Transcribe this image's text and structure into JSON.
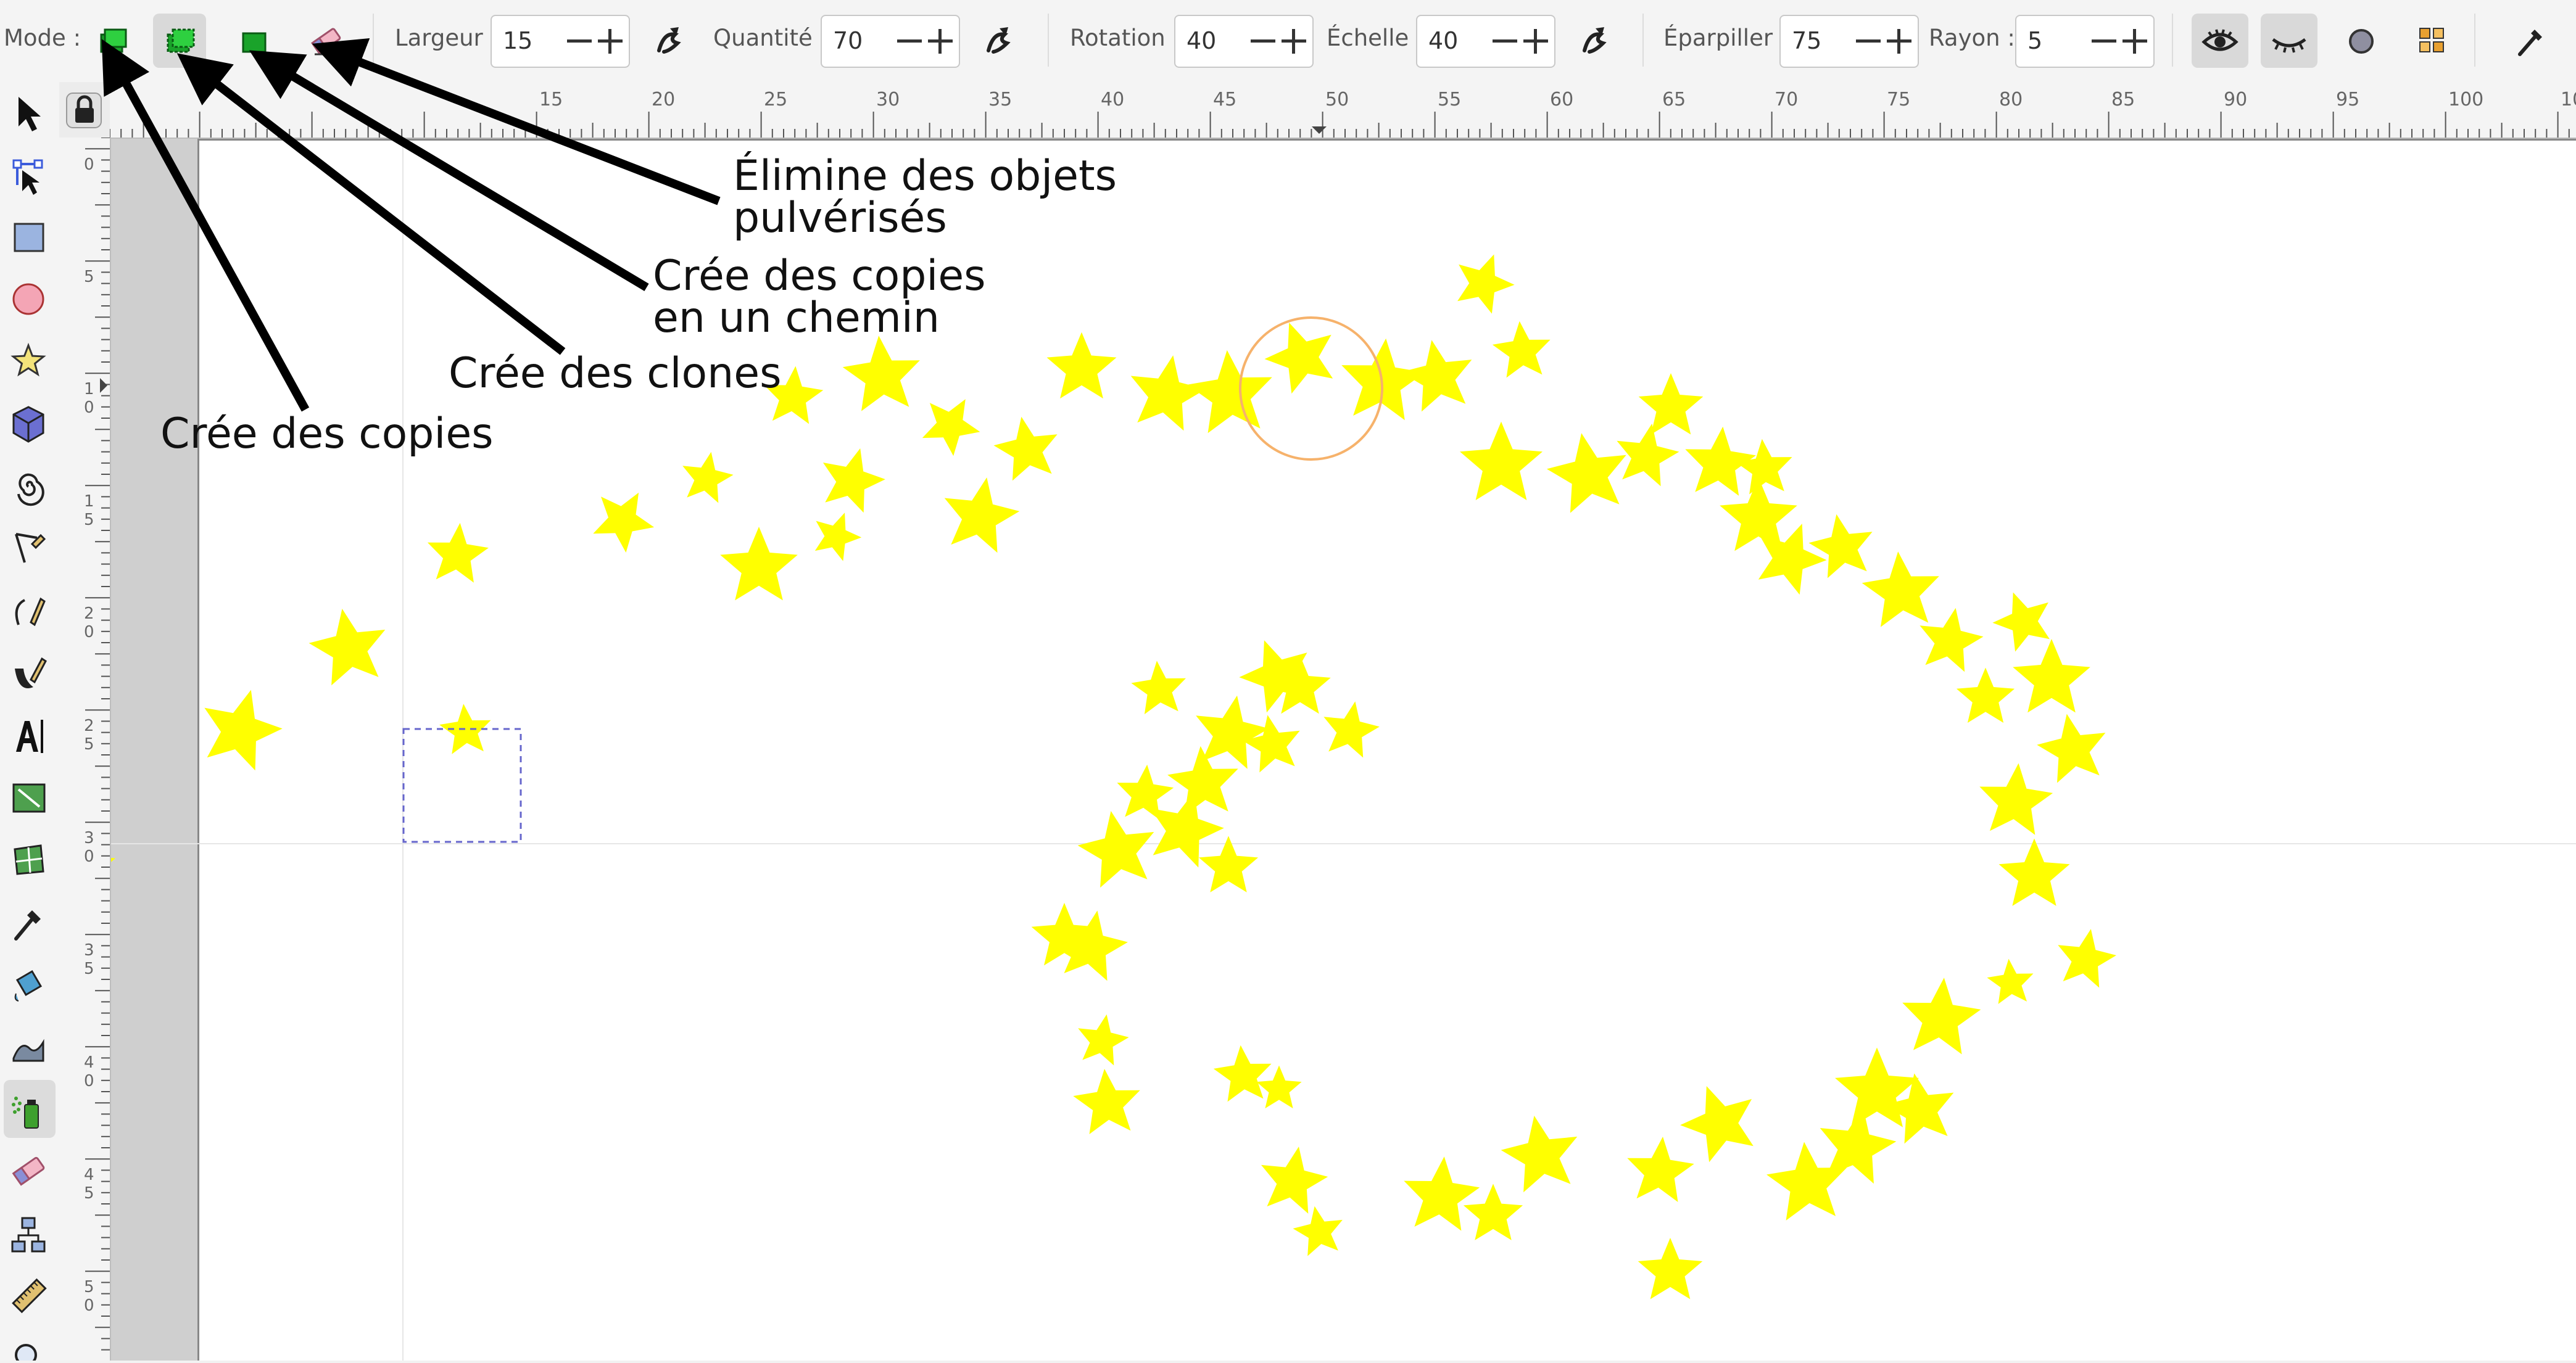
{
  "toolbar": {
    "mode_label": "Mode :",
    "mode_buttons": [
      {
        "name": "copies",
        "icon": "spray-copies-icon",
        "active": false
      },
      {
        "name": "clones",
        "icon": "spray-clones-icon",
        "active": true
      },
      {
        "name": "single-path",
        "icon": "spray-single-path-icon",
        "active": false
      },
      {
        "name": "delete",
        "icon": "spray-eraser-icon",
        "active": false
      }
    ],
    "width_label": "Largeur :",
    "width_value": "15",
    "amount_label": "Quantité :",
    "amount_value": "70",
    "rotation_label": "Rotation :",
    "rotation_value": "40",
    "scale_label": "Échelle :",
    "scale_value": "40",
    "scatter_label": "Éparpiller :",
    "scatter_value": "75",
    "radius_label": "Rayon :",
    "radius_value": "5",
    "pressure_icon": "pen-pressure-icon",
    "visibility_icons": [
      "eye-icon",
      "eye-closed-icon",
      "circle-icon",
      "pick-color-icon",
      "dropper-icon"
    ]
  },
  "rulers": {
    "horizontal_ticks": [
      "15",
      "20",
      "25",
      "30",
      "35",
      "40",
      "45",
      "50",
      "55",
      "60",
      "65",
      "70",
      "75",
      "80",
      "85",
      "90",
      "95",
      "100",
      "10"
    ],
    "vertical_ticks": [
      "0",
      "5",
      "10",
      "15",
      "20",
      "25",
      "30",
      "35",
      "40",
      "45",
      "50"
    ]
  },
  "tools": [
    "selector-arrow-icon",
    "node-editor-icon",
    "rectangle-icon",
    "ellipse-icon",
    "star-icon",
    "box3d-icon",
    "spiral-icon",
    "pencil-icon",
    "pen-bezier-icon",
    "calligraphy-icon",
    "text-icon",
    "gradient-icon",
    "mesh-icon",
    "dropper-icon",
    "paint-bucket-icon",
    "tweak-icon",
    "spray-icon",
    "eraser-icon",
    "connector-icon",
    "measure-icon",
    "zoom-icon"
  ],
  "annotations": {
    "erase": [
      "Élimine des objets",
      "pulvérisés"
    ],
    "path": [
      "Crée des copies",
      "en un chemin"
    ],
    "clones": "Crée des clones",
    "copies": "Crée des copies"
  },
  "colors": {
    "star": "#ffff00",
    "spray_circle": "#f6b26b",
    "selection": "#6666cc",
    "accent_green": "#1aa32a"
  }
}
